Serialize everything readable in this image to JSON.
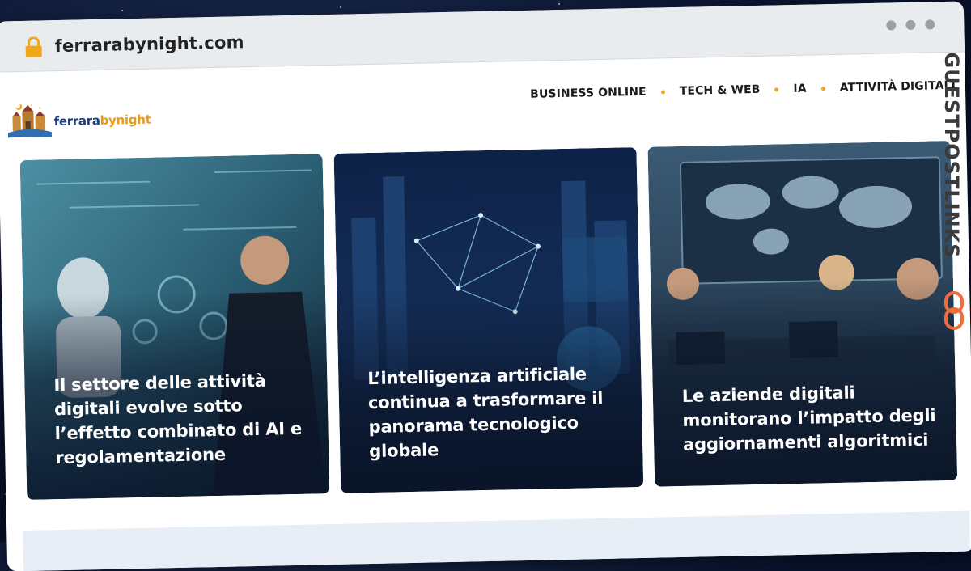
{
  "browser": {
    "url": "ferrarabynight.com"
  },
  "site": {
    "logo_text_main": "ferrara",
    "logo_text_accent": "bynight"
  },
  "nav": {
    "items": [
      {
        "label": "BUSINESS ONLINE"
      },
      {
        "label": "TECH & WEB"
      },
      {
        "label": "IA"
      },
      {
        "label": "ATTIVITÀ DIGITALI"
      }
    ]
  },
  "cards": [
    {
      "title": "Il settore delle attività digitali evolve sotto l’effetto combinato di AI e regolamentazione"
    },
    {
      "title": "L’intelligenza artificiale continua a trasformare il panorama tecnologico globale"
    },
    {
      "title": "Le aziende digitali monitorano l’impatto degli aggiornamenti algoritmici"
    }
  ],
  "watermark": {
    "text": "GUESTPOSTLINKS"
  },
  "colors": {
    "accent": "#f0a81a",
    "logo_blue": "#1d3e7a",
    "logo_orange": "#e79a1e",
    "watermark_icon": "#f26b3a"
  }
}
